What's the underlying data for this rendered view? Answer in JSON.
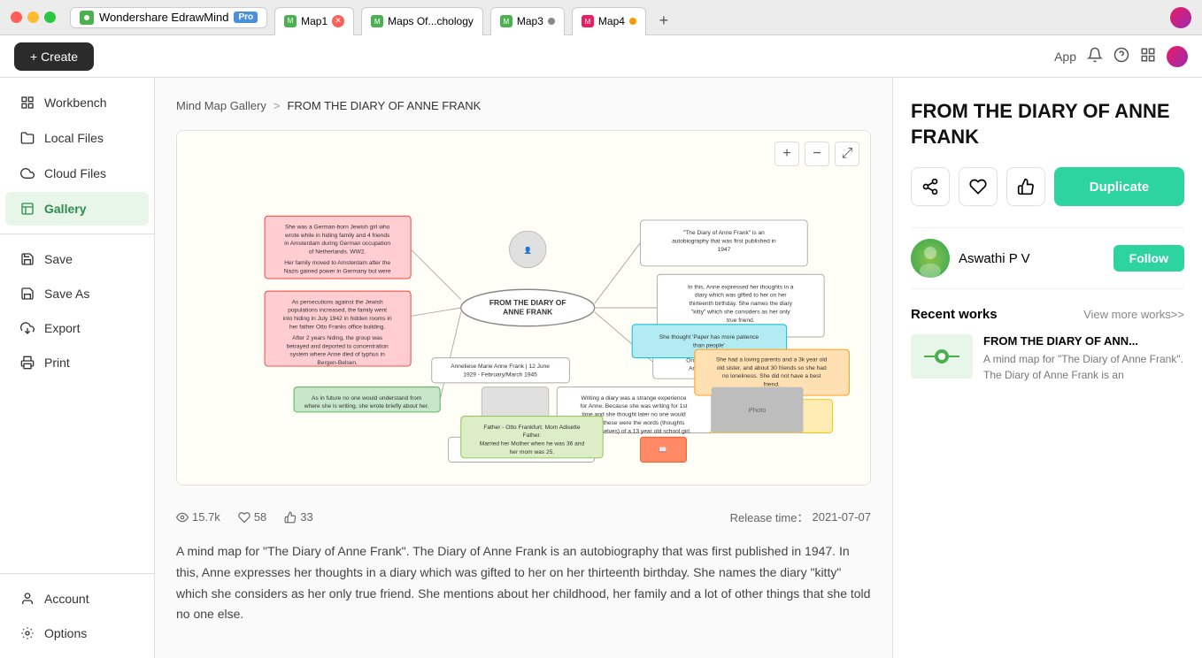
{
  "titlebar": {
    "app_name": "Wondershare EdrawMind",
    "pro_badge": "Pro",
    "tabs": [
      {
        "label": "Map1",
        "color": "green",
        "active": true
      },
      {
        "label": "Maps Of...chology",
        "color": "green",
        "active": false
      },
      {
        "label": "Map3",
        "color": "green",
        "active": false
      },
      {
        "label": "Map4",
        "color": "orange",
        "active": false
      }
    ],
    "add_tab": "+"
  },
  "toolbar": {
    "create_label": "+ Create",
    "app_label": "App",
    "icons": [
      "bell",
      "help",
      "grid",
      "user"
    ]
  },
  "sidebar": {
    "items": [
      {
        "id": "workbench",
        "label": "Workbench",
        "icon": "grid"
      },
      {
        "id": "local-files",
        "label": "Local Files",
        "icon": "folder"
      },
      {
        "id": "cloud-files",
        "label": "Cloud Files",
        "icon": "cloud"
      },
      {
        "id": "gallery",
        "label": "Gallery",
        "icon": "image",
        "active": true
      }
    ],
    "bottom_items": [
      {
        "id": "save",
        "label": "Save",
        "icon": "save"
      },
      {
        "id": "save-as",
        "label": "Save As",
        "icon": "save-as"
      },
      {
        "id": "export",
        "label": "Export",
        "icon": "export"
      },
      {
        "id": "print",
        "label": "Print",
        "icon": "print"
      }
    ],
    "account_items": [
      {
        "id": "account",
        "label": "Account",
        "icon": "account"
      },
      {
        "id": "options",
        "label": "Options",
        "icon": "settings"
      }
    ]
  },
  "breadcrumb": {
    "parent": "Mind Map Gallery",
    "separator": ">",
    "current": "FROM THE DIARY OF ANNE FRANK"
  },
  "map_controls": {
    "zoom_in": "+",
    "zoom_out": "−",
    "fullscreen": "⤢"
  },
  "stats": {
    "views": "15.7k",
    "likes": "58",
    "thumbs": "33",
    "release_label": "Release time：",
    "release_date": "2021-07-07"
  },
  "description": "A mind map for \"The Diary of Anne Frank\". The Diary of Anne Frank is an autobiography that was first published in 1947. In this, Anne expresses her thoughts in a diary which was gifted to her on her thirteenth birthday. She names the diary \"kitty\" which she considers as her only true friend. She mentions about her childhood, her family and a lot of other things that she told no one else.",
  "right_panel": {
    "title": "FROM THE DIARY OF ANNE FRANK",
    "actions": {
      "share_icon": "share",
      "heart_icon": "heart",
      "thumb_icon": "thumb",
      "duplicate_label": "Duplicate"
    },
    "author": {
      "name": "Aswathi P V",
      "follow_label": "Follow"
    },
    "recent": {
      "title": "Recent works",
      "view_more": "View more works>>",
      "items": [
        {
          "title": "FROM THE DIARY OF ANN...",
          "description": "A mind map for \"The Diary of Anne Frank\". The Diary of Anne Frank is an"
        }
      ]
    }
  }
}
